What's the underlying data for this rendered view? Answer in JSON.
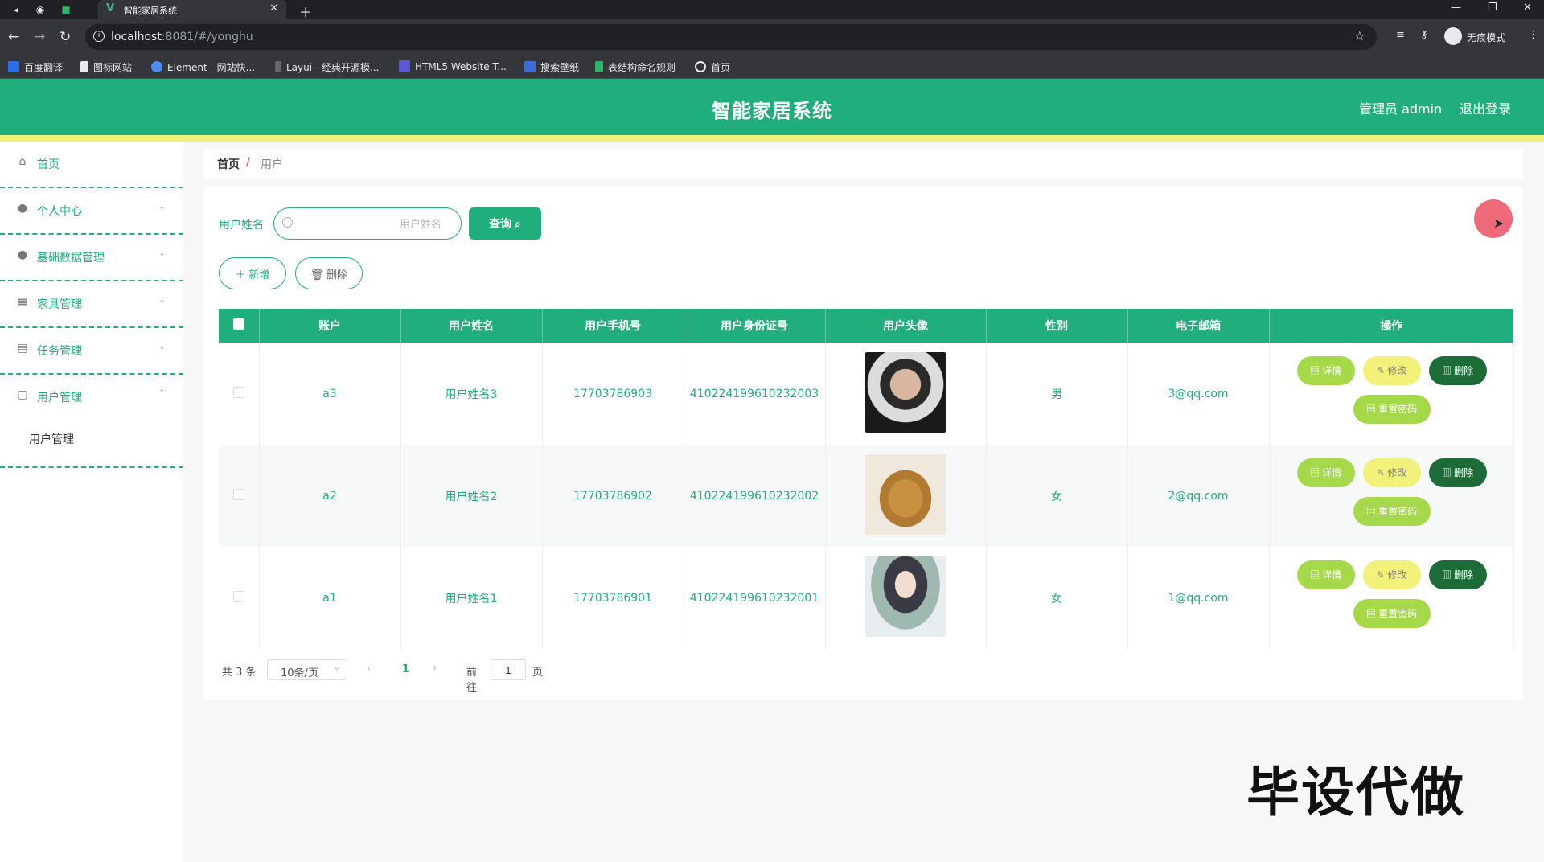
{
  "browser": {
    "tab_title": "智能家居系统",
    "url_host": "localhost",
    "url_path": ":8081/#/yonghu",
    "incognito_label": "无痕模式",
    "bookmarks": [
      "百度翻译",
      "图标网站",
      "Element - 网站快...",
      "Layui - 经典开源模...",
      "HTML5 Website T...",
      "搜索壁纸",
      "表结构命名规则",
      "首页"
    ]
  },
  "header": {
    "title": "智能家居系统",
    "admin": "管理员 admin",
    "logout": "退出登录"
  },
  "sidebar": {
    "items": [
      {
        "label": "首页",
        "icon": "home-icon"
      },
      {
        "label": "个人中心",
        "icon": "user-icon"
      },
      {
        "label": "基础数据管理",
        "icon": "user-icon"
      },
      {
        "label": "家具管理",
        "icon": "grid-icon"
      },
      {
        "label": "任务管理",
        "icon": "clipboard-icon"
      },
      {
        "label": "用户管理",
        "icon": "box-icon"
      }
    ],
    "sub_item": "用户管理"
  },
  "breadcrumb": {
    "home": "首页",
    "sep": "/",
    "current": "用户"
  },
  "search": {
    "label": "用户姓名",
    "placeholder": "用户姓名",
    "query_button": "查询"
  },
  "actions": {
    "add": "＋ 新增",
    "delete": "删除"
  },
  "table": {
    "columns": [
      "账户",
      "用户姓名",
      "用户手机号",
      "用户身份证号",
      "用户头像",
      "性别",
      "电子邮箱",
      "操作"
    ],
    "rows": [
      {
        "account": "a3",
        "name": "用户姓名3",
        "phone": "17703786903",
        "id_card": "410224199610232003",
        "gender": "男",
        "email": "3@qq.com"
      },
      {
        "account": "a2",
        "name": "用户姓名2",
        "phone": "17703786902",
        "id_card": "410224199610232002",
        "gender": "女",
        "email": "2@qq.com"
      },
      {
        "account": "a1",
        "name": "用户姓名1",
        "phone": "17703786901",
        "id_card": "410224199610232001",
        "gender": "女",
        "email": "1@qq.com"
      }
    ],
    "row_actions": {
      "detail": "详情",
      "edit": "修改",
      "delete": "删除",
      "reset": "重置密码"
    }
  },
  "pagination": {
    "total": "共 3 条",
    "page_size": "10条/页",
    "current": "1",
    "goto": "前往",
    "goto_value": "1",
    "page_suffix": "页"
  },
  "watermark": "毕设代做",
  "colors": {
    "primary": "#1fae7c",
    "stripe": "#f0f07a",
    "detail": "#a6d94a",
    "edit": "#f2f27a",
    "delete": "#1d6b36"
  }
}
